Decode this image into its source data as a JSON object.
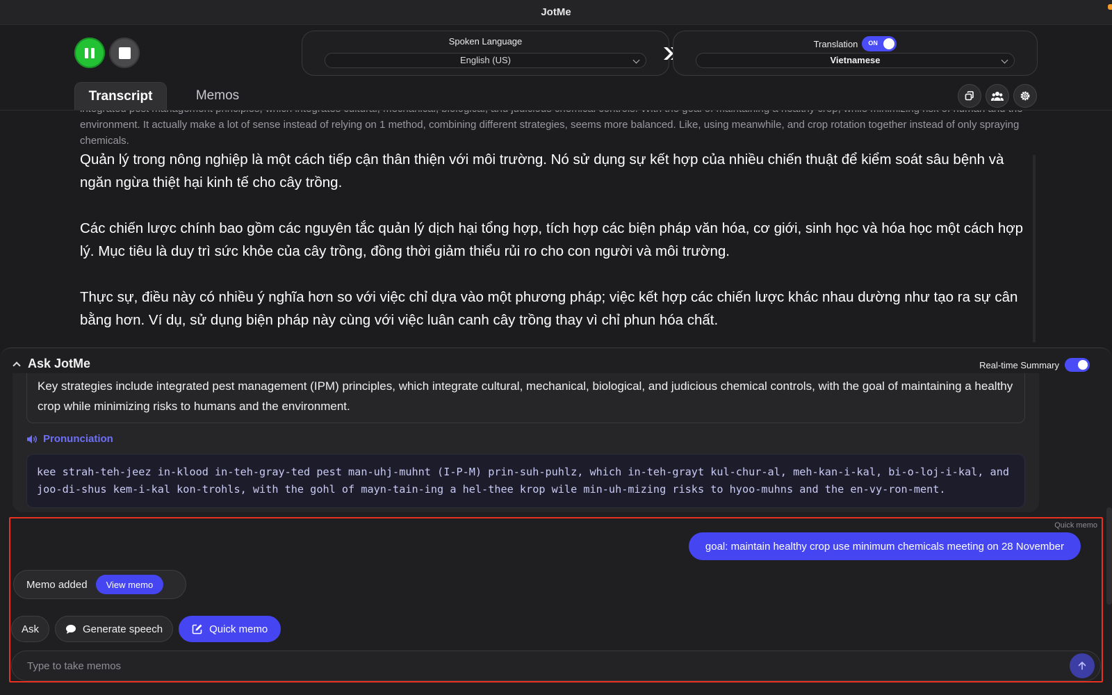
{
  "app": {
    "title": "JotMe"
  },
  "controls": {
    "spoken_language_label": "Spoken Language",
    "spoken_language_value": "English (US)",
    "translation_label": "Translation",
    "translation_toggle": "ON",
    "translation_value": "Vietnamese"
  },
  "tabs": [
    {
      "label": "Transcript",
      "active": true
    },
    {
      "label": "Memos",
      "active": false
    }
  ],
  "transcript": {
    "original": "integrated pest management principles, which integrates cultural, mechanical, biological, and judicious chemical controls. With the goal of maintaining a healthy crop, while minimizing risk of human and the environment. It actually make a lot of sense instead of relying on 1 method, combining different strategies, seems more balanced. Like, using meanwhile, and crop rotation together instead of only spraying chemicals.",
    "translated": [
      "Quản lý trong nông nghiệp là một cách tiếp cận thân thiện với môi trường. Nó sử dụng sự kết hợp của nhiều chiến thuật để kiểm soát sâu bệnh và ngăn ngừa thiệt hại kinh tế cho cây trồng.",
      "Các chiến lược chính bao gồm các nguyên tắc quản lý dịch hại tổng hợp, tích hợp các biện pháp văn hóa, cơ giới, sinh học và hóa học một cách hợp lý. Mục tiêu là duy trì sức khỏe của cây trồng, đồng thời giảm thiểu rủi ro cho con người và môi trường.",
      "Thực sự, điều này có nhiều ý nghĩa hơn so với việc chỉ dựa vào một phương pháp; việc kết hợp các chiến lược khác nhau dường như tạo ra sự cân bằng hơn. Ví dụ, sử dụng biện pháp này cùng với việc luân canh cây trồng thay vì chỉ phun hóa chất."
    ]
  },
  "ask": {
    "title": "Ask JotMe",
    "summary_label": "Real-time Summary",
    "answer": "Key strategies include integrated pest management (IPM) principles, which integrate cultural, mechanical, biological, and judicious chemical controls, with the goal of maintaining a healthy crop while minimizing risks to humans and the environment.",
    "pronunciation_label": "Pronunciation",
    "pronunciation": "kee strah-teh-jeez in-klood in-teh-gray-ted pest man-uhj-muhnt (I-P-M) prin-suh-puhlz, which in-teh-grayt kul-chur-al, meh-kan-i-kal, bi-o-loj-i-kal, and joo-di-shus kem-i-kal kon-trohls, with the gohl of mayn-tain-ing a hel-thee krop wile min-uh-mizing risks to hyoo-muhns and the en-vy-ron-ment."
  },
  "memo": {
    "quick_memo_caption": "Quick memo",
    "bubble_text": "goal: maintain healthy crop use minimum chemicals meeting on 28 November",
    "memo_added_label": "Memo added",
    "view_memo_label": "View memo",
    "actions": {
      "ask": "Ask",
      "generate_speech": "Generate speech",
      "quick_memo": "Quick memo"
    },
    "input_placeholder": "Type to take memos"
  },
  "colors": {
    "accent": "#4545f2",
    "record": "#23c234",
    "highlight_border": "#e8321f"
  }
}
